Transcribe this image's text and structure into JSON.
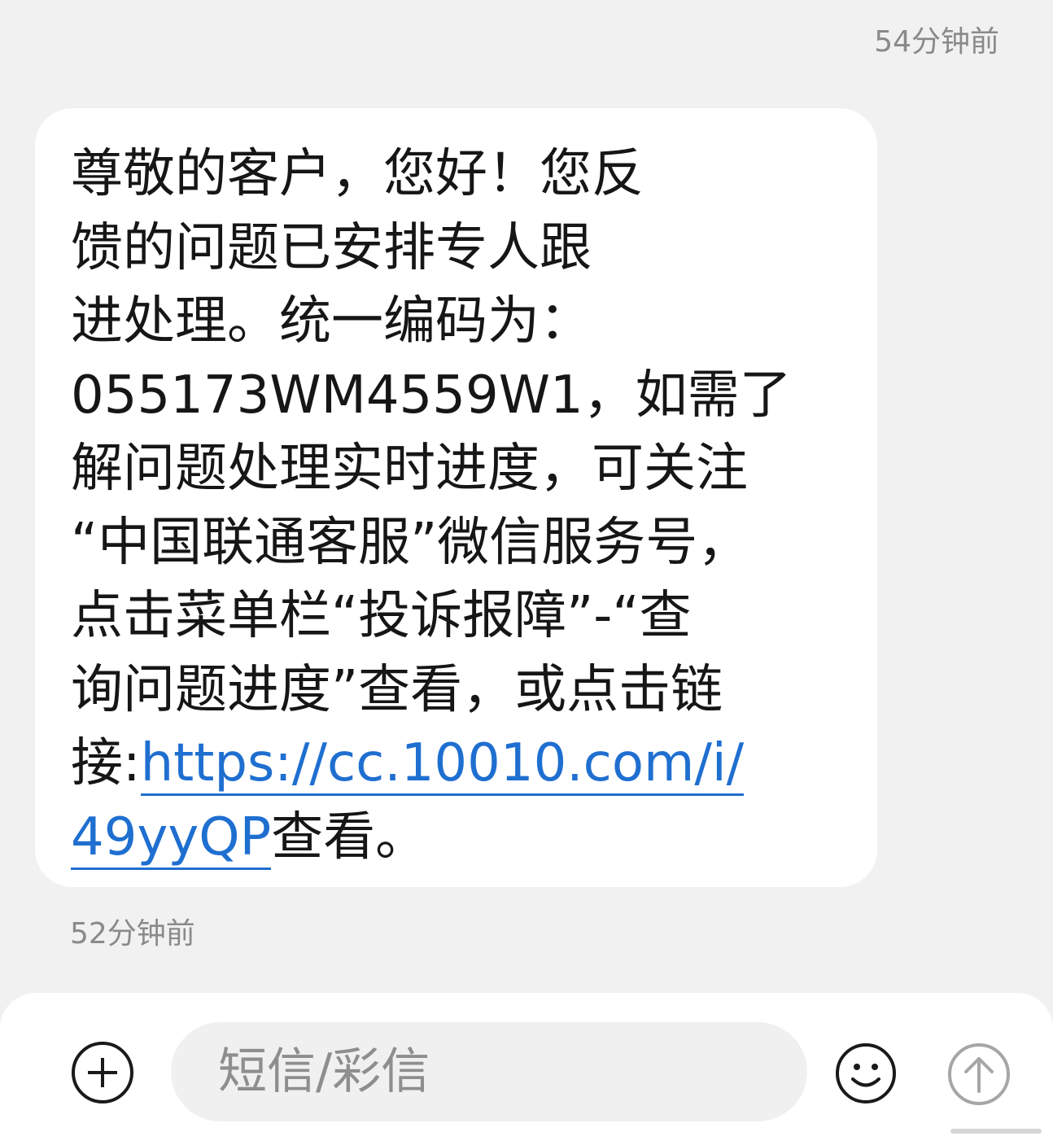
{
  "messages": [
    {
      "timestamp": "54分钟前",
      "lines": [
        {
          "text": "尊敬的客户，您好！您反"
        },
        {
          "text": "馈的问题已安排专人跟"
        },
        {
          "text": "进处理。统一编码为："
        },
        {
          "text": "055173WM4559W1，如需了"
        },
        {
          "text": "解问题处理实时进度，可关注"
        },
        {
          "text": "“中国联通客服”微信服务号，"
        },
        {
          "text": "点击菜单栏“投诉报障”-“查"
        },
        {
          "text": "询问题进度”查看，或点击链"
        },
        {
          "prefix": "接:",
          "link": "https://cc.10010.com/i/"
        },
        {
          "link": "49yyQP",
          "suffix": "查看。"
        }
      ]
    },
    {
      "timestamp": "52分钟前"
    }
  ],
  "compose": {
    "placeholder": "短信/彩信",
    "value": ""
  },
  "icons": {
    "add": "plus-circle-icon",
    "emoji": "smiley-icon",
    "send": "arrow-up-circle-icon"
  },
  "colors": {
    "background": "#f1f1f2",
    "bubble": "#ffffff",
    "link": "#1f6fd0",
    "timestamp": "#8a8a8a"
  }
}
